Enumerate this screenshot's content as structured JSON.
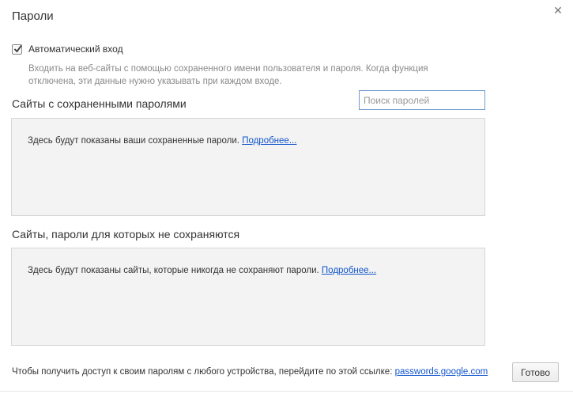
{
  "dialog": {
    "title": "Пароли",
    "close_icon": "close-icon"
  },
  "autologin": {
    "label": "Автоматический вход",
    "checked": true,
    "hint": "Входить на веб-сайты с помощью сохраненного имени пользователя и пароля. Когда функция отключена, эти данные нужно указывать при каждом входе."
  },
  "saved": {
    "title": "Сайты с сохраненными паролями",
    "search_placeholder": "Поиск паролей",
    "empty_text": "Здесь будут показаны ваши сохраненные пароли.",
    "more_link": "Подробнее..."
  },
  "never_saved": {
    "title": "Сайты, пароли для которых не сохраняются",
    "empty_text": "Здесь будут показаны сайты, которые никогда не сохраняют пароли.",
    "more_link": "Подробнее..."
  },
  "footer": {
    "text": "Чтобы получить доступ к своим паролям с любого устройства, перейдите по этой ссылке:",
    "link": "passwords.google.com",
    "done_label": "Готово"
  },
  "colors": {
    "link": "#1155cc",
    "list_bg": "#f3f3f3",
    "search_border": "#6f9bd1"
  }
}
